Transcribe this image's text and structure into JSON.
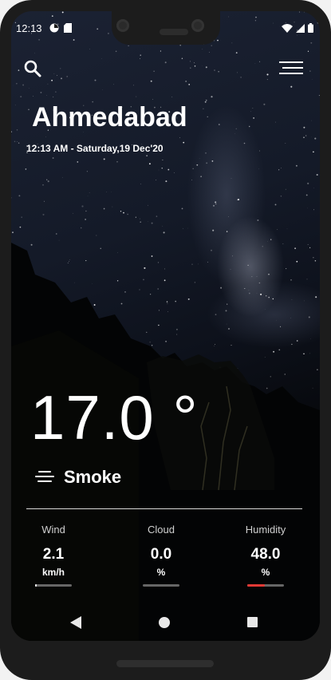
{
  "status_bar": {
    "time": "12:13",
    "left_icons": [
      "signal-status-icon",
      "sd-card-icon"
    ],
    "right_icons": [
      "wifi-icon",
      "cell-signal-icon",
      "battery-icon"
    ]
  },
  "header": {
    "search_icon": "search-icon",
    "menu_icon": "hamburger-menu-icon"
  },
  "location": {
    "city": "Ahmedabad",
    "datetime": "12:13 AM - Saturday,19 Dec'20"
  },
  "current": {
    "temperature": "17.0 °",
    "condition_icon": "haze-icon",
    "condition": "Smoke"
  },
  "stats": [
    {
      "label": "Wind",
      "value": "2.1",
      "unit": "km/h",
      "level": 0.02,
      "color": "#ffffff"
    },
    {
      "label": "Cloud",
      "value": "0.0",
      "unit": "%",
      "level": 0.0,
      "color": "#ffffff"
    },
    {
      "label": "Humidity",
      "value": "48.0",
      "unit": "%",
      "level": 0.48,
      "color": "#e53935"
    }
  ],
  "navigation": {
    "back_icon": "back-triangle-icon",
    "home_icon": "home-circle-icon",
    "recents_icon": "recents-square-icon"
  }
}
